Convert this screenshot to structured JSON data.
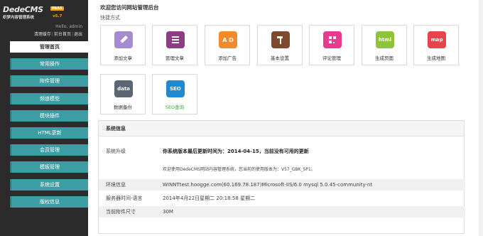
{
  "sidebar": {
    "logo": {
      "main": "DedeCMS",
      "badge": "PAAS",
      "sub": "织梦内容管理系统",
      "version": "v5.7"
    },
    "user": {
      "hello": "Hello, admin",
      "links": [
        "清理缓存",
        "前台首页",
        "退出"
      ]
    },
    "items": [
      {
        "label": "管理首页"
      },
      {
        "label": "常用操作"
      },
      {
        "label": "附件管理"
      },
      {
        "label": "频道模型"
      },
      {
        "label": "模块插件"
      },
      {
        "label": "HTML更新"
      },
      {
        "label": "会员管理"
      },
      {
        "label": "模板管理"
      },
      {
        "label": "系统设置"
      },
      {
        "label": "版权信息"
      }
    ]
  },
  "main": {
    "welcome": "欢迎您访问网站管理后台",
    "shortcut_title": "快捷方式",
    "tiles": [
      {
        "label": "添加文章",
        "icon": "pencil-icon",
        "color": "#a58bd0"
      },
      {
        "label": "管理文章",
        "icon": "stack-icon",
        "color": "#8e3d84"
      },
      {
        "label": "添加广告",
        "icon": "ad-icon",
        "text": "A D",
        "color": "#f08a2b"
      },
      {
        "label": "基本设置",
        "icon": "hammer-icon",
        "color": "#7d4a2e"
      },
      {
        "label": "评论管理",
        "icon": "comment-grid-icon",
        "color": "#e83a8f"
      },
      {
        "label": "生成页面",
        "icon": "html-icon",
        "text": "html",
        "color": "#8cc43c"
      },
      {
        "label": "生成地图",
        "icon": "map-icon",
        "text": "map",
        "color": "#e8424a"
      },
      {
        "label": "数据备份",
        "icon": "data-icon",
        "text": "data",
        "color": "#5a6672"
      },
      {
        "label": "SEO查询",
        "icon": "seo-icon",
        "text": "SEO",
        "color": "#1f8ad0",
        "green": true
      }
    ],
    "sysinfo": {
      "title": "系统信息",
      "upgrade_label": "系统升级",
      "upgrade_line1": "你系统版本最后更新时间为：2014-04-15，当前没有可用的更新",
      "upgrade_line2": "欢迎使用DedeCMS网站内容管理系统，您当前的使用版本为：V57_GBK_SP1。",
      "rows": [
        {
          "k": "环境信息",
          "v": "WINNTtest.hoogge.com(60.169.78.187)Microsoft-IIS/6.0 mysql 5.0.45-community-nt"
        },
        {
          "k": "服务器时间-语言",
          "v": "2014年4月22日星期二 20:18:58 星期二"
        },
        {
          "k": "当前附件尺寸",
          "v": "30M"
        }
      ]
    }
  }
}
